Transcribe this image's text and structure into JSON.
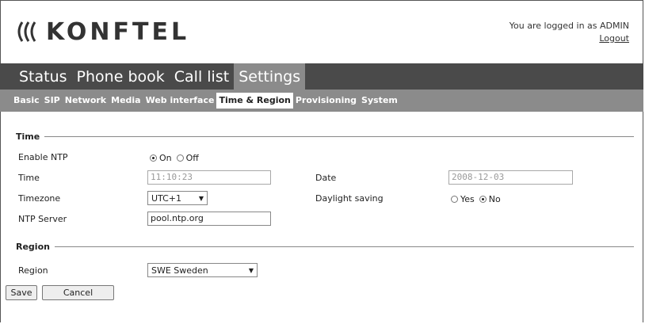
{
  "header": {
    "logo_text": "KONFTEL",
    "login_text": "You are logged in as ADMIN",
    "logout_label": "Logout"
  },
  "main_nav": [
    {
      "label": "Status",
      "active": false
    },
    {
      "label": "Phone book",
      "active": false
    },
    {
      "label": "Call list",
      "active": false
    },
    {
      "label": "Settings",
      "active": true
    }
  ],
  "sub_nav": [
    {
      "label": "Basic",
      "active": false
    },
    {
      "label": "SIP",
      "active": false
    },
    {
      "label": "Network",
      "active": false
    },
    {
      "label": "Media",
      "active": false
    },
    {
      "label": "Web interface",
      "active": false
    },
    {
      "label": "Time & Region",
      "active": true
    },
    {
      "label": "Provisioning",
      "active": false
    },
    {
      "label": "System",
      "active": false
    }
  ],
  "time_section": {
    "title": "Time",
    "enable_ntp_label": "Enable NTP",
    "ntp_on_label": "On",
    "ntp_off_label": "Off",
    "ntp_selected": "On",
    "time_label": "Time",
    "time_value": "11:10:23",
    "date_label": "Date",
    "date_value": "2008-12-03",
    "timezone_label": "Timezone",
    "timezone_value": "UTC+1",
    "daylight_label": "Daylight saving",
    "daylight_yes_label": "Yes",
    "daylight_no_label": "No",
    "daylight_selected": "No",
    "ntp_server_label": "NTP Server",
    "ntp_server_value": "pool.ntp.org"
  },
  "region_section": {
    "title": "Region",
    "region_label": "Region",
    "region_value": "SWE Sweden"
  },
  "actions": {
    "save_label": "Save",
    "cancel_label": "Cancel"
  }
}
